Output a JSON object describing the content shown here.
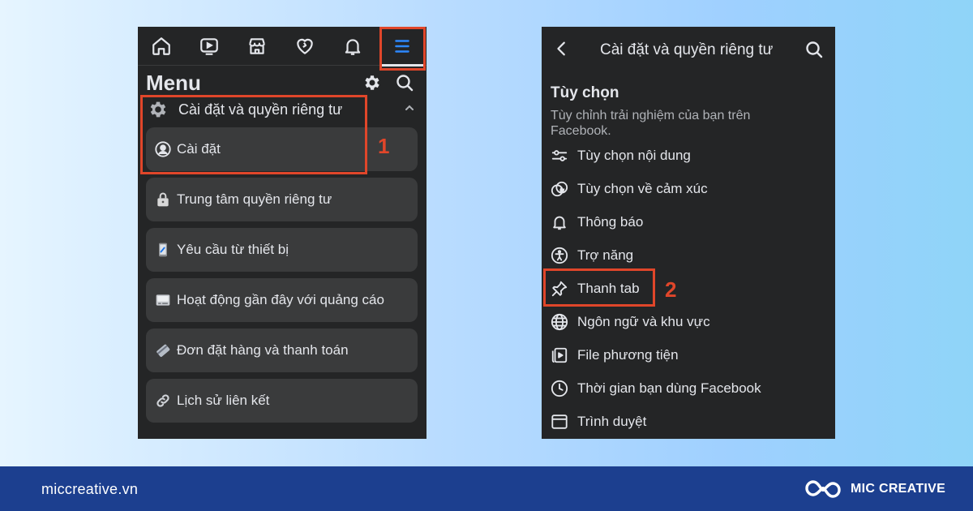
{
  "left_phone": {
    "nav": [
      "home-icon",
      "video-icon",
      "marketplace-icon",
      "dating-icon",
      "bell-icon",
      "menu-icon"
    ],
    "menu_title": "Menu",
    "section_label": "Cài đặt và quyền riêng tư",
    "items": [
      {
        "label": "Cài đặt",
        "icon": "user-circle-icon"
      },
      {
        "label": "Trung tâm quyền riêng tư",
        "icon": "lock-icon"
      },
      {
        "label": "Yêu cầu từ thiết bị",
        "icon": "device-icon"
      },
      {
        "label": "Hoạt động gần đây với quảng cáo",
        "icon": "ad-activity-icon"
      },
      {
        "label": "Đơn đặt hàng và thanh toán",
        "icon": "card-icon"
      },
      {
        "label": "Lịch sử liên kết",
        "icon": "link-icon"
      }
    ],
    "step_label": "1"
  },
  "right_phone": {
    "title": "Cài đặt và quyền riêng tư",
    "section_title": "Tùy chọn",
    "section_desc": "Tùy chỉnh trải nghiệm của bạn trên Facebook.",
    "items": [
      {
        "label": "Tùy chọn nội dung",
        "icon": "sliders-icon"
      },
      {
        "label": "Tùy chọn về cảm xúc",
        "icon": "reaction-icon"
      },
      {
        "label": "Thông báo",
        "icon": "bell-icon"
      },
      {
        "label": "Trợ năng",
        "icon": "accessibility-icon"
      },
      {
        "label": "Thanh tab",
        "icon": "pin-icon"
      },
      {
        "label": "Ngôn ngữ và khu vực",
        "icon": "globe-icon"
      },
      {
        "label": "File phương tiện",
        "icon": "media-icon"
      },
      {
        "label": "Thời gian bạn dùng Facebook",
        "icon": "clock-icon"
      },
      {
        "label": "Trình duyệt",
        "icon": "browser-icon"
      }
    ],
    "step_label": "2"
  },
  "footer": {
    "url": "miccreative.vn",
    "brand": "MIC CREATIVE"
  },
  "colors": {
    "highlight": "#e0462a",
    "app_bg": "#242526",
    "card_bg": "#3a3b3c",
    "active_blue": "#2d88ff",
    "footer_bg": "#1c3f8f"
  }
}
